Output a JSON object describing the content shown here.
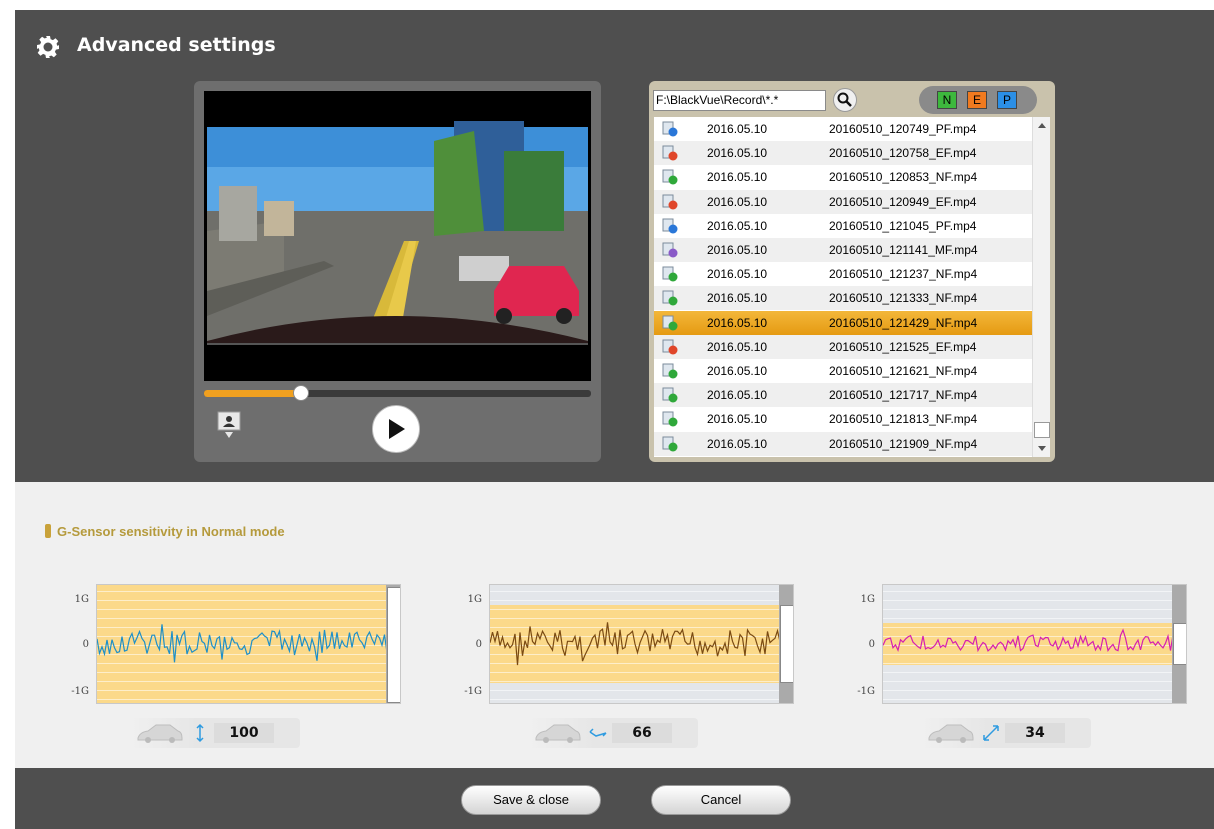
{
  "header": {
    "title": "Advanced settings",
    "icon": "gear-icon"
  },
  "player": {
    "progress_fraction": 0.25,
    "snapshot_icon": "snapshot-icon",
    "play_icon": "play-icon"
  },
  "filelist": {
    "path": "F:\\BlackVue\\Record\\*.*",
    "filters": [
      {
        "label": "N",
        "color": "#3db83d"
      },
      {
        "label": "E",
        "color": "#f07a1f"
      },
      {
        "label": "P",
        "color": "#2b8fe6"
      }
    ],
    "rows": [
      {
        "type": "P",
        "date": "2016.05.10",
        "name": "20160510_120749_PF.mp4",
        "selected": false
      },
      {
        "type": "E",
        "date": "2016.05.10",
        "name": "20160510_120758_EF.mp4",
        "selected": false
      },
      {
        "type": "N",
        "date": "2016.05.10",
        "name": "20160510_120853_NF.mp4",
        "selected": false
      },
      {
        "type": "E",
        "date": "2016.05.10",
        "name": "20160510_120949_EF.mp4",
        "selected": false
      },
      {
        "type": "P",
        "date": "2016.05.10",
        "name": "20160510_121045_PF.mp4",
        "selected": false
      },
      {
        "type": "M",
        "date": "2016.05.10",
        "name": "20160510_121141_MF.mp4",
        "selected": false
      },
      {
        "type": "N",
        "date": "2016.05.10",
        "name": "20160510_121237_NF.mp4",
        "selected": false
      },
      {
        "type": "N",
        "date": "2016.05.10",
        "name": "20160510_121333_NF.mp4",
        "selected": false
      },
      {
        "type": "N",
        "date": "2016.05.10",
        "name": "20160510_121429_NF.mp4",
        "selected": true
      },
      {
        "type": "E",
        "date": "2016.05.10",
        "name": "20160510_121525_EF.mp4",
        "selected": false
      },
      {
        "type": "N",
        "date": "2016.05.10",
        "name": "20160510_121621_NF.mp4",
        "selected": false
      },
      {
        "type": "N",
        "date": "2016.05.10",
        "name": "20160510_121717_NF.mp4",
        "selected": false
      },
      {
        "type": "N",
        "date": "2016.05.10",
        "name": "20160510_121813_NF.mp4",
        "selected": false
      },
      {
        "type": "N",
        "date": "2016.05.10",
        "name": "20160510_121909_NF.mp4",
        "selected": false
      }
    ]
  },
  "sensitivity": {
    "title": "G-Sensor sensitivity in Normal mode",
    "axis": {
      "top": "1G",
      "mid": "0",
      "bottom": "-1G"
    },
    "graphs": [
      {
        "axis_icon": "vertical-arrow-icon",
        "value": "100",
        "line_color": "#1e8fc8"
      },
      {
        "axis_icon": "horizontal-arrow-icon",
        "value": "66",
        "line_color": "#7a4a12"
      },
      {
        "axis_icon": "diagonal-arrow-icon",
        "value": "34",
        "line_color": "#d61fb0"
      }
    ]
  },
  "footer": {
    "save_label": "Save & close",
    "cancel_label": "Cancel"
  }
}
